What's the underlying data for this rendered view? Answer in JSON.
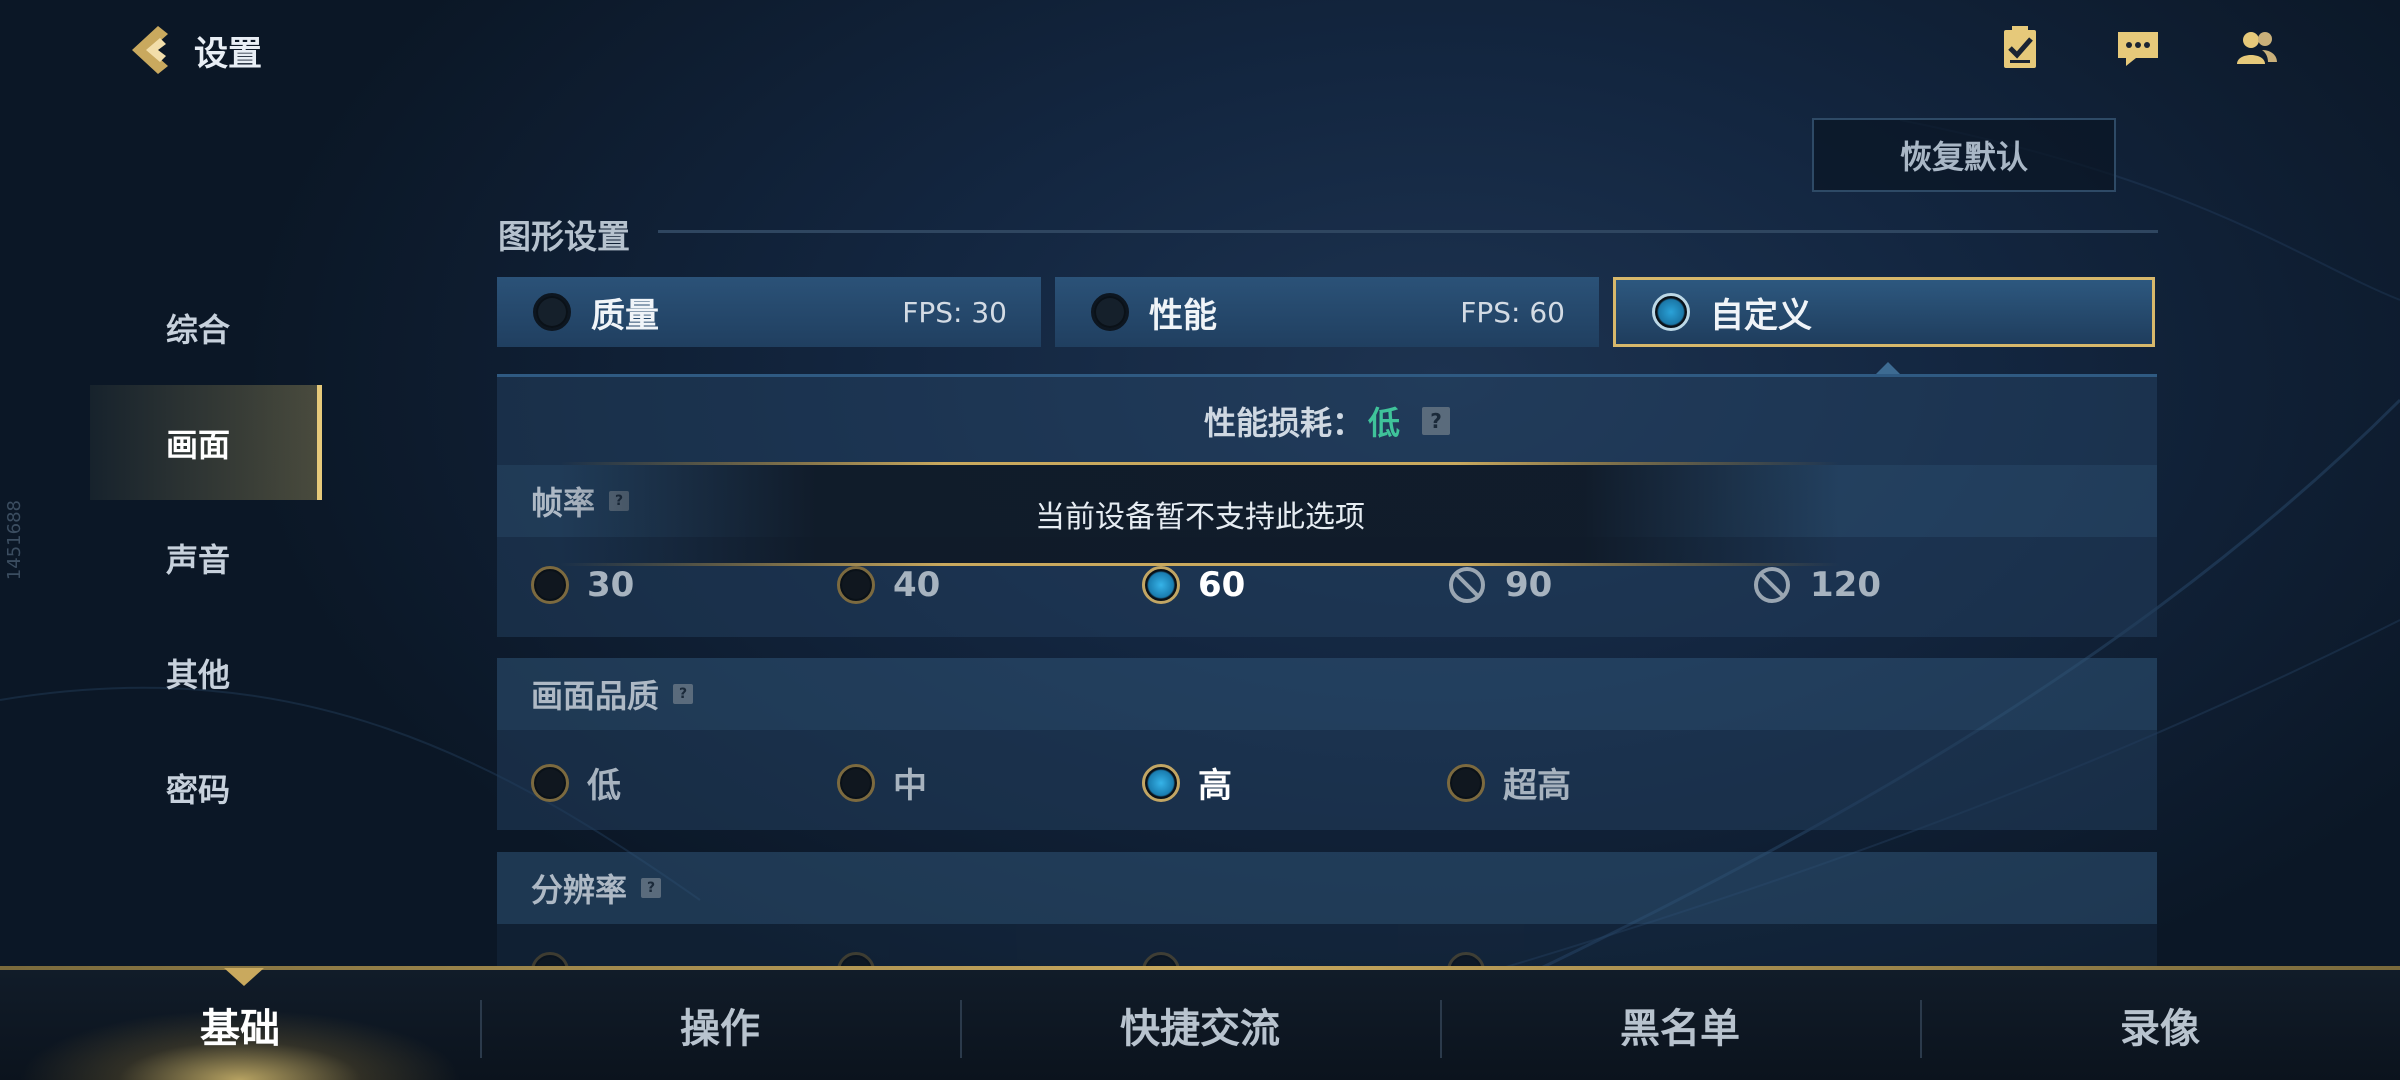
{
  "header": {
    "title": "设置"
  },
  "reset_label": "恢复默认",
  "sidenav": {
    "items": [
      {
        "label": "综合"
      },
      {
        "label": "画面"
      },
      {
        "label": "声音"
      },
      {
        "label": "其他"
      },
      {
        "label": "密码"
      }
    ],
    "active": "画面"
  },
  "graphics": {
    "section_title": "图形设置",
    "presets": [
      {
        "label": "质量",
        "fps": "FPS: 30",
        "selected": false
      },
      {
        "label": "性能",
        "fps": "FPS: 60",
        "selected": false
      },
      {
        "label": "自定义",
        "fps": "",
        "selected": true
      }
    ],
    "perf_label": "性能损耗：",
    "perf_value": "低",
    "help_glyph": "?"
  },
  "framerate": {
    "title": "帧率",
    "tooltip": "当前设备暂不支持此选项",
    "options": [
      {
        "label": "30",
        "state": "off"
      },
      {
        "label": "40",
        "state": "off"
      },
      {
        "label": "60",
        "state": "selected"
      },
      {
        "label": "90",
        "state": "unavailable"
      },
      {
        "label": "120",
        "state": "unavailable"
      }
    ]
  },
  "quality": {
    "title": "画面品质",
    "options": [
      {
        "label": "低",
        "state": "off"
      },
      {
        "label": "中",
        "state": "off"
      },
      {
        "label": "高",
        "state": "selected"
      },
      {
        "label": "超高",
        "state": "off"
      }
    ]
  },
  "resolution": {
    "title": "分辨率"
  },
  "side_id": "1451688",
  "bottom_tabs": [
    {
      "label": "基础",
      "active": true
    },
    {
      "label": "操作",
      "active": false
    },
    {
      "label": "快捷交流",
      "active": false
    },
    {
      "label": "黑名单",
      "active": false
    },
    {
      "label": "录像",
      "active": false
    }
  ],
  "colors": {
    "accent_gold": "#c9a95e",
    "perf_green": "#3fc39a",
    "radio_blue": "#2aa2d8"
  }
}
